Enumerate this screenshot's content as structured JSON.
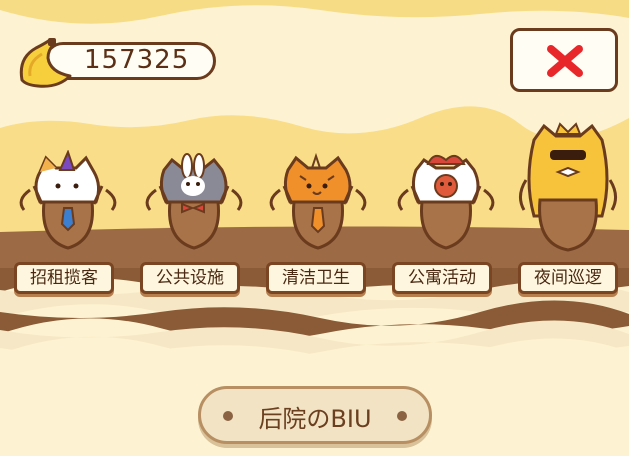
{
  "hud": {
    "currency_icon": "banana-icon",
    "currency_value": "157325",
    "close_icon": "close-icon",
    "accent_color": "#e8272b"
  },
  "categories": [
    {
      "label": "招租揽客",
      "character": "cat-mascot-with-party-hat"
    },
    {
      "label": "公共设施",
      "character": "bunny-mascot-with-bowtie"
    },
    {
      "label": "清洁卫生",
      "character": "tabby-cat-mascot-with-tie"
    },
    {
      "label": "公寓活动",
      "character": "monkey-mascot-with-jester-hat"
    },
    {
      "label": "夜间巡逻",
      "character": "cat-mascot-with-crown-and-sunglasses"
    }
  ],
  "footer": {
    "label": "后院のBIU"
  },
  "colors": {
    "background": "#fdf3d2",
    "band": "#f7dc86",
    "shelf": "#9c6a45",
    "outline": "#6b3b1e"
  }
}
